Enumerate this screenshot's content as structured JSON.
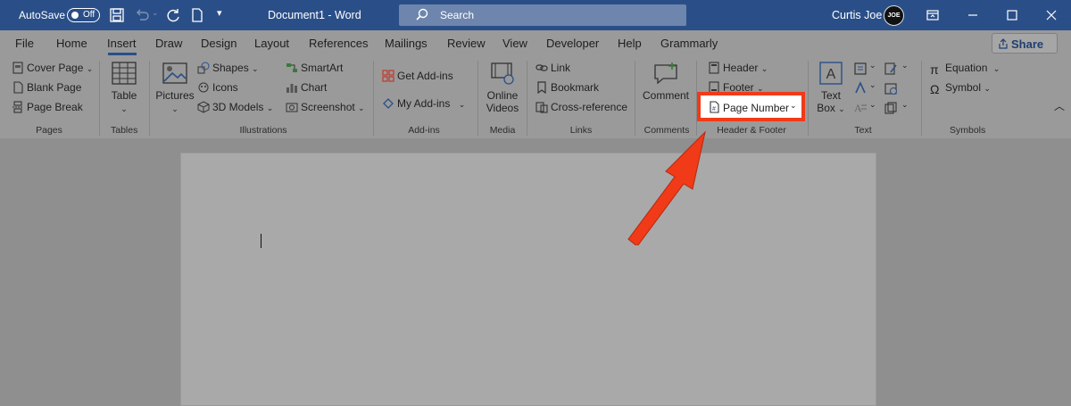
{
  "titlebar": {
    "autosave_label": "AutoSave",
    "autosave_state": "Off",
    "document_title": "Document1  -  Word",
    "search_placeholder": "Search",
    "user_name": "Curtis Joe",
    "avatar_text": "JOE"
  },
  "tabs": [
    "File",
    "Home",
    "Insert",
    "Draw",
    "Design",
    "Layout",
    "References",
    "Mailings",
    "Review",
    "View",
    "Developer",
    "Help",
    "Grammarly"
  ],
  "active_tab": "Insert",
  "share_label": "Share",
  "groups": {
    "pages": {
      "label": "Pages",
      "items": [
        "Cover Page",
        "Blank Page",
        "Page Break"
      ]
    },
    "tables": {
      "label": "Tables",
      "table": "Table"
    },
    "illustrations": {
      "label": "Illustrations",
      "pictures": "Pictures",
      "items": [
        "Shapes",
        "Icons",
        "3D Models",
        "SmartArt",
        "Chart",
        "Screenshot"
      ]
    },
    "addins": {
      "label": "Add-ins",
      "items": [
        "Get Add-ins",
        "My Add-ins"
      ]
    },
    "media": {
      "label": "Media",
      "online_videos_1": "Online",
      "online_videos_2": "Videos"
    },
    "links": {
      "label": "Links",
      "items": [
        "Link",
        "Bookmark",
        "Cross-reference"
      ]
    },
    "comments": {
      "label": "Comments",
      "comment": "Comment"
    },
    "header_footer": {
      "label": "Header & Footer",
      "items": [
        "Header",
        "Footer",
        "Page Number"
      ]
    },
    "text": {
      "label": "Text",
      "text_box_1": "Text",
      "text_box_2": "Box"
    },
    "symbols": {
      "label": "Symbols",
      "items": [
        "Equation",
        "Symbol"
      ]
    }
  },
  "colors": {
    "titlebar": "#2a4f88",
    "highlight": "#f03a18",
    "arrow": "#f03a18"
  }
}
